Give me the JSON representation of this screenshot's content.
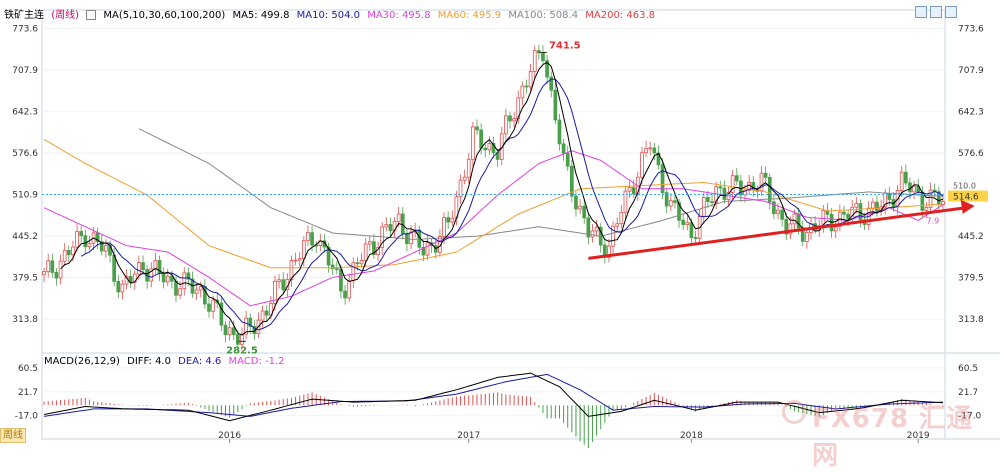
{
  "header": {
    "instrument": "铁矿主连",
    "period": "周线",
    "ma_label": "MA(5,10,30,60,100,200)",
    "ma_values": [
      {
        "label": "MA5: 499.8",
        "color": "#000000"
      },
      {
        "label": "MA10: 504.0",
        "color": "#1a1aa6"
      },
      {
        "label": "MA30: 495.8",
        "color": "#e040e0"
      },
      {
        "label": "MA60: 495.9",
        "color": "#f0a030"
      },
      {
        "label": "MA100: 508.4",
        "color": "#888888"
      },
      {
        "label": "MA200: 463.8",
        "color": "#e04040"
      }
    ]
  },
  "macd_header": {
    "label": "MACD(26,12,9)",
    "diff": "DIFF: 4.0",
    "dea": "DEA: 4.6",
    "macd": "MACD: -1.2"
  },
  "period_tab": "周线",
  "watermark": "FX678 汇通网",
  "colors": {
    "up": "#e15050",
    "down": "#4aa04a",
    "ma5": "#000000",
    "ma10": "#1a1aa6",
    "ma30": "#e040e0",
    "ma60": "#f0a030",
    "ma100": "#888888",
    "trend": "#e02020",
    "current_line": "#33aaee"
  },
  "chart_data": {
    "type": "candlestick",
    "y_ticks_main": [
      "773.6",
      "707.9",
      "642.3",
      "576.6",
      "510.9",
      "445.2",
      "379.5",
      "313.8"
    ],
    "y_ticks_macd": [
      "60.5",
      "21.7",
      "-17.0"
    ],
    "x_ticks": [
      "2016",
      "2017",
      "2018",
      "2019"
    ],
    "ylim_main": [
      273.0,
      790.0
    ],
    "ylim_macd": [
      -32.0,
      70.0
    ],
    "annotations": {
      "high": "741.5",
      "low": "282.5",
      "current_price": "514.6",
      "current_right": "510.0",
      "current_marker": "510.9",
      "ma_tail_label": "7.9"
    },
    "price_anchors": [
      {
        "t": 0,
        "v": 380
      },
      {
        "t": 6,
        "v": 420
      },
      {
        "t": 10,
        "v": 450
      },
      {
        "t": 15,
        "v": 420
      },
      {
        "t": 19,
        "v": 360
      },
      {
        "t": 24,
        "v": 400
      },
      {
        "t": 30,
        "v": 375
      },
      {
        "t": 38,
        "v": 360
      },
      {
        "t": 44,
        "v": 300
      },
      {
        "t": 48,
        "v": 285
      },
      {
        "t": 54,
        "v": 330
      },
      {
        "t": 60,
        "v": 400
      },
      {
        "t": 66,
        "v": 450
      },
      {
        "t": 72,
        "v": 360
      },
      {
        "t": 79,
        "v": 430
      },
      {
        "t": 86,
        "v": 470
      },
      {
        "t": 92,
        "v": 420
      },
      {
        "t": 98,
        "v": 460
      },
      {
        "t": 104,
        "v": 600
      },
      {
        "t": 110,
        "v": 580
      },
      {
        "t": 116,
        "v": 680
      },
      {
        "t": 121,
        "v": 741
      },
      {
        "t": 126,
        "v": 560
      },
      {
        "t": 132,
        "v": 450
      },
      {
        "t": 137,
        "v": 430
      },
      {
        "t": 142,
        "v": 520
      },
      {
        "t": 147,
        "v": 590
      },
      {
        "t": 152,
        "v": 490
      },
      {
        "t": 157,
        "v": 450
      },
      {
        "t": 163,
        "v": 520
      },
      {
        "t": 168,
        "v": 520
      },
      {
        "t": 174,
        "v": 530
      },
      {
        "t": 180,
        "v": 460
      },
      {
        "t": 185,
        "v": 455
      },
      {
        "t": 190,
        "v": 470
      },
      {
        "t": 196,
        "v": 480
      },
      {
        "t": 203,
        "v": 490
      },
      {
        "t": 208,
        "v": 530
      },
      {
        "t": 213,
        "v": 505
      },
      {
        "t": 218,
        "v": 500
      }
    ],
    "ma_anchors": {
      "ma100": [
        {
          "t": 23,
          "v": 615
        },
        {
          "t": 40,
          "v": 560
        },
        {
          "t": 55,
          "v": 490
        },
        {
          "t": 70,
          "v": 450
        },
        {
          "t": 90,
          "v": 440
        },
        {
          "t": 105,
          "v": 445
        },
        {
          "t": 120,
          "v": 460
        },
        {
          "t": 135,
          "v": 445
        },
        {
          "t": 150,
          "v": 470
        },
        {
          "t": 165,
          "v": 500
        },
        {
          "t": 180,
          "v": 505
        },
        {
          "t": 200,
          "v": 515
        },
        {
          "t": 218,
          "v": 508
        }
      ],
      "ma60": [
        {
          "t": 0,
          "v": 598
        },
        {
          "t": 10,
          "v": 560
        },
        {
          "t": 25,
          "v": 510
        },
        {
          "t": 40,
          "v": 430
        },
        {
          "t": 55,
          "v": 395
        },
        {
          "t": 70,
          "v": 395
        },
        {
          "t": 85,
          "v": 400
        },
        {
          "t": 100,
          "v": 420
        },
        {
          "t": 115,
          "v": 480
        },
        {
          "t": 130,
          "v": 520
        },
        {
          "t": 145,
          "v": 525
        },
        {
          "t": 160,
          "v": 530
        },
        {
          "t": 175,
          "v": 515
        },
        {
          "t": 190,
          "v": 485
        },
        {
          "t": 205,
          "v": 490
        },
        {
          "t": 218,
          "v": 496
        }
      ],
      "ma30": [
        {
          "t": 0,
          "v": 490
        },
        {
          "t": 10,
          "v": 460
        },
        {
          "t": 20,
          "v": 430
        },
        {
          "t": 30,
          "v": 420
        },
        {
          "t": 40,
          "v": 380
        },
        {
          "t": 50,
          "v": 335
        },
        {
          "t": 60,
          "v": 350
        },
        {
          "t": 70,
          "v": 380
        },
        {
          "t": 80,
          "v": 390
        },
        {
          "t": 90,
          "v": 420
        },
        {
          "t": 100,
          "v": 450
        },
        {
          "t": 110,
          "v": 510
        },
        {
          "t": 120,
          "v": 560
        },
        {
          "t": 128,
          "v": 580
        },
        {
          "t": 135,
          "v": 565
        },
        {
          "t": 145,
          "v": 520
        },
        {
          "t": 155,
          "v": 520
        },
        {
          "t": 165,
          "v": 510
        },
        {
          "t": 175,
          "v": 500
        },
        {
          "t": 185,
          "v": 475
        },
        {
          "t": 195,
          "v": 470
        },
        {
          "t": 205,
          "v": 490
        },
        {
          "t": 212,
          "v": 470
        },
        {
          "t": 218,
          "v": 495
        }
      ]
    },
    "trend_line": {
      "from": {
        "t": 132,
        "v": 410
      },
      "to": {
        "t": 216,
        "v": 485
      }
    },
    "macd_anchors": {
      "diff": [
        {
          "t": 0,
          "v": -15
        },
        {
          "t": 10,
          "v": -2
        },
        {
          "t": 20,
          "v": -6
        },
        {
          "t": 35,
          "v": -8
        },
        {
          "t": 45,
          "v": -25
        },
        {
          "t": 55,
          "v": -8
        },
        {
          "t": 65,
          "v": 10
        },
        {
          "t": 75,
          "v": 5
        },
        {
          "t": 90,
          "v": 8
        },
        {
          "t": 100,
          "v": 25
        },
        {
          "t": 110,
          "v": 45
        },
        {
          "t": 118,
          "v": 52
        },
        {
          "t": 125,
          "v": 30
        },
        {
          "t": 132,
          "v": -18
        },
        {
          "t": 140,
          "v": -10
        },
        {
          "t": 148,
          "v": 8
        },
        {
          "t": 158,
          "v": -8
        },
        {
          "t": 168,
          "v": 5
        },
        {
          "t": 178,
          "v": 5
        },
        {
          "t": 188,
          "v": -12
        },
        {
          "t": 198,
          "v": -5
        },
        {
          "t": 208,
          "v": 8
        },
        {
          "t": 218,
          "v": 4
        }
      ],
      "dea": [
        {
          "t": 0,
          "v": -18
        },
        {
          "t": 12,
          "v": -6
        },
        {
          "t": 25,
          "v": -6
        },
        {
          "t": 40,
          "v": -12
        },
        {
          "t": 50,
          "v": -18
        },
        {
          "t": 60,
          "v": -5
        },
        {
          "t": 72,
          "v": 6
        },
        {
          "t": 88,
          "v": 7
        },
        {
          "t": 100,
          "v": 18
        },
        {
          "t": 112,
          "v": 38
        },
        {
          "t": 122,
          "v": 50
        },
        {
          "t": 130,
          "v": 25
        },
        {
          "t": 138,
          "v": -8
        },
        {
          "t": 148,
          "v": -2
        },
        {
          "t": 160,
          "v": -3
        },
        {
          "t": 170,
          "v": 2
        },
        {
          "t": 182,
          "v": 3
        },
        {
          "t": 192,
          "v": -6
        },
        {
          "t": 205,
          "v": 2
        },
        {
          "t": 218,
          "v": 5
        }
      ]
    },
    "total_bars": 219
  }
}
